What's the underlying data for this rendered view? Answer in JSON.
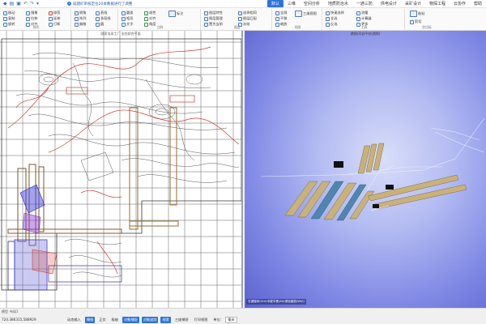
{
  "quick_access": {
    "icons": [
      "app-icon",
      "open-icon",
      "save-icon",
      "undo-icon",
      "redo-icon",
      "dropdown-icon"
    ]
  },
  "notice": {
    "text": "届建矿审核定位20本数据进行了调整"
  },
  "menus": [
    "默认",
    "三维",
    "空间分析",
    "地质防治水",
    "一通三防",
    "供电设计",
    "采矿设计",
    "物探工程",
    "云协作",
    "帮助"
  ],
  "ribbon": {
    "edit_tools": [
      "移动",
      "复制",
      "旋转",
      "镜像",
      "拉伸",
      "对齐",
      "修剪",
      "延伸",
      "打断",
      "倒角",
      "阵列",
      "偏移"
    ],
    "draw_tools": [
      "直线",
      "多段线",
      "圆",
      "圆弧",
      "矩形",
      "文字"
    ],
    "annotate_tools": [
      "线性",
      "对齐",
      "角度",
      "标注"
    ],
    "layer_tools": [
      "图层特性",
      "图层管理",
      "置为当前",
      "选择相同",
      "图层匹配",
      "冻结"
    ],
    "view_tools": [
      "全屏",
      "平移",
      "缩放",
      "三维视图"
    ],
    "select_tools": [
      "快速选择",
      "全选",
      "反选"
    ],
    "util_tools": [
      "测量",
      "计算器",
      "更多"
    ],
    "clipboard_tools": [
      "粘贴",
      "剪切"
    ],
    "group_labels": [
      "修改",
      "注释",
      "图层",
      "视图",
      "工具",
      "剪切板"
    ]
  },
  "left_view": {
    "caption": "顾家沟采工厂  支柱综合平面"
  },
  "right_view": {
    "caption": "透视(3)自平台(透视)",
    "coord_tag": "右键旋转(Ctrl)中键平移(Alt)滚轮缩放(Wnl)"
  },
  "status": {
    "tabs": [
      "模型",
      "布局1"
    ],
    "coord": "724.386315,588929",
    "buttons": [
      {
        "label": "动态输入",
        "on": false
      },
      {
        "label": "栅格",
        "on": true
      },
      {
        "label": "正交",
        "on": false
      },
      {
        "label": "极轴",
        "on": false
      },
      {
        "label": "对象捕捉",
        "on": true
      },
      {
        "label": "对象追踪",
        "on": true
      },
      {
        "label": "线宽",
        "on": true
      },
      {
        "label": "三维捕捉",
        "on": false
      },
      {
        "label": "打印视图",
        "on": false
      }
    ],
    "unit_label": "单位:",
    "unit_value": "毫米"
  },
  "colors": {
    "accent": "#2e73d8",
    "viewport_bg": "#7f88e4",
    "contour_red": "#d23a2e",
    "mine_blue": "#3b3bd4"
  }
}
